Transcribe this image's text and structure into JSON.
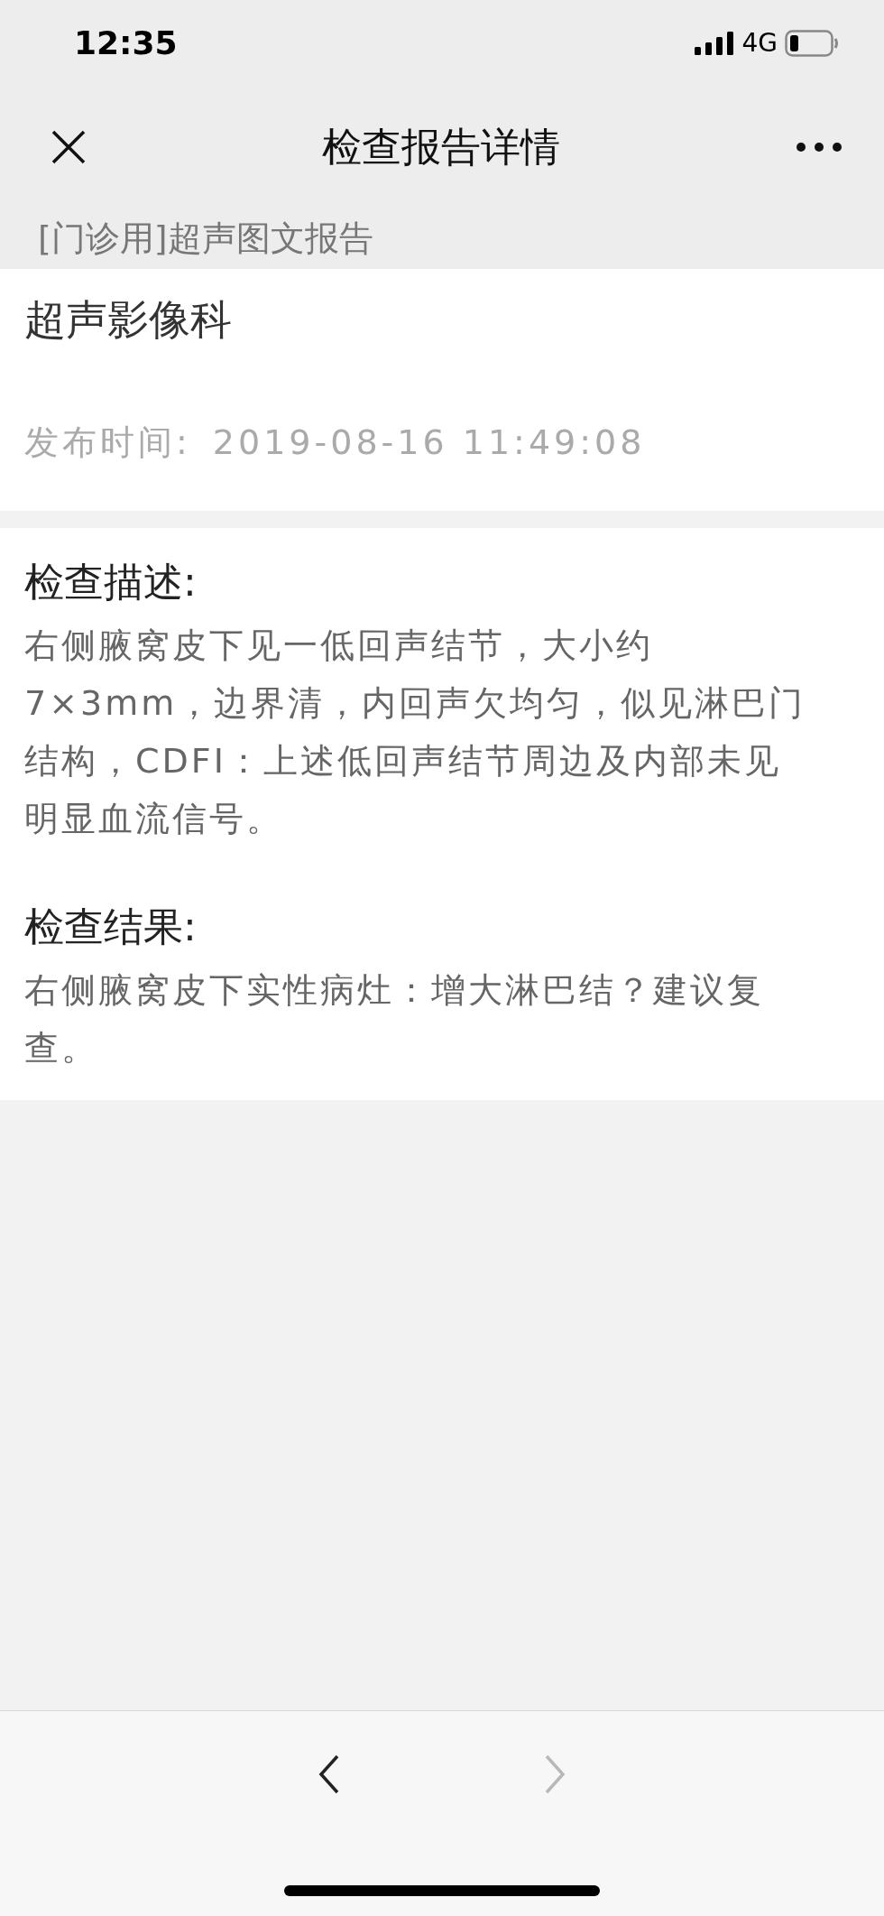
{
  "status_bar": {
    "time": "12:35",
    "network": "4G"
  },
  "nav_bar": {
    "title": "检查报告详情"
  },
  "report_type": "[门诊用]超声图文报告",
  "department": {
    "name": "超声影像科",
    "publish_label": "发布时间:",
    "publish_time": "2019-08-16 11:49:08"
  },
  "sections": [
    {
      "heading": "检查描述:",
      "body": "右侧腋窝皮下见一低回声结节，大小约7×3mm，边界清，内回声欠均匀，似见淋巴门结构，CDFI：上述低回声结节周边及内部未见明显血流信号。"
    },
    {
      "heading": "检查结果:",
      "body": "右侧腋窝皮下实性病灶：增大淋巴结？建议复查。"
    }
  ],
  "toolbar": {
    "back": {
      "disabled": false
    },
    "forward": {
      "disabled": true
    }
  }
}
